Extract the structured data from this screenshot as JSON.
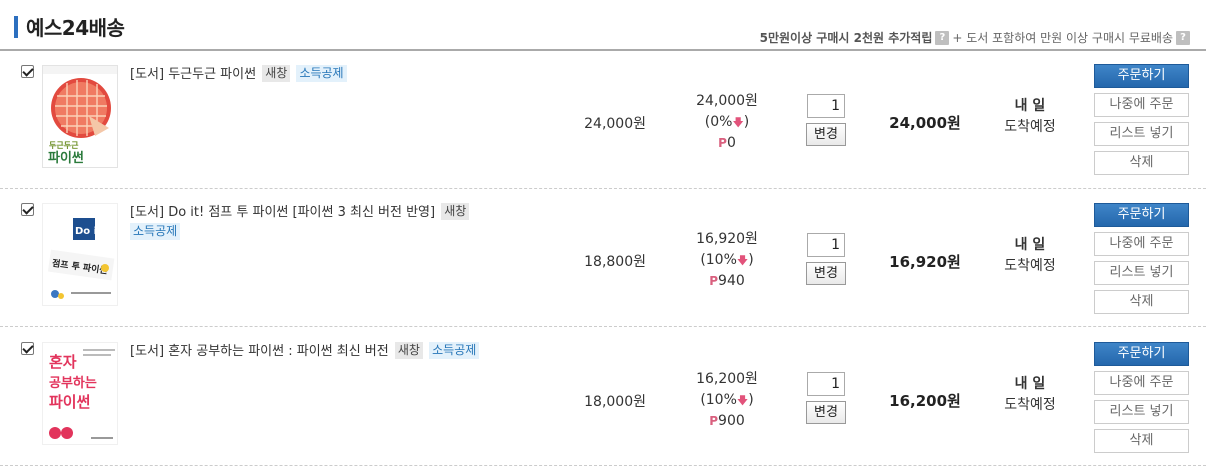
{
  "header": {
    "title": "예스24배송",
    "notice_strong": "5만원이상 구매시 2천원 추가적립",
    "notice_rest": "+ 도서 포함하여 만원 이상 구매시 무료배송",
    "help_glyph": "?"
  },
  "rows": [
    {
      "checked": true,
      "product_name": "[도서] 두근두근 파이썬",
      "badge_new": "새창",
      "badge_tax": "소득공제",
      "list_price": "24,000원",
      "sale_price": "24,000원",
      "discount": "(0%",
      "down_arrow": "🡇",
      "point_icon": "P",
      "points": "0",
      "quantity": "1",
      "change_label": "변경",
      "total": "24,000원",
      "delivery_day": "내 일",
      "delivery_note": "도착예정",
      "order_label": "주문하기",
      "later_label": "나중에 주문",
      "list_label": "리스트 넣기",
      "delete_label": "삭제",
      "cover": {
        "label1": "두근두근",
        "label2": "파이썬"
      }
    },
    {
      "checked": true,
      "product_name": "[도서] Do it! 점프 투 파이썬 [파이썬 3 최신 버전 반영]",
      "badge_new": "새창",
      "badge_tax": "소득공제",
      "list_price": "18,800원",
      "sale_price": "16,920원",
      "discount": "(10%",
      "down_arrow": "🡇",
      "point_icon": "P",
      "points": "940",
      "quantity": "1",
      "change_label": "변경",
      "total": "16,920원",
      "delivery_day": "내 일",
      "delivery_note": "도착예정",
      "order_label": "주문하기",
      "later_label": "나중에 주문",
      "list_label": "리스트 넣기",
      "delete_label": "삭제",
      "cover": {
        "label1": "Do it!",
        "label2": "점프 투 파이썬"
      }
    },
    {
      "checked": true,
      "product_name": "[도서] 혼자 공부하는 파이썬 : 파이썬 최신 버전",
      "badge_new": "새창",
      "badge_tax": "소득공제",
      "list_price": "18,000원",
      "sale_price": "16,200원",
      "discount": "(10%",
      "down_arrow": "🡇",
      "point_icon": "P",
      "points": "900",
      "quantity": "1",
      "change_label": "변경",
      "total": "16,200원",
      "delivery_day": "내 일",
      "delivery_note": "도착예정",
      "order_label": "주문하기",
      "later_label": "나중에 주문",
      "list_label": "리스트 넣기",
      "delete_label": "삭제",
      "cover": {
        "label1": "혼자",
        "label2": "공부하는",
        "label3": "파이썬"
      }
    }
  ],
  "colors": {
    "accent": "#2c6fbf",
    "order_button": "#2467ac",
    "discount_arrow": "#e2537b",
    "point": "#d9607f"
  }
}
